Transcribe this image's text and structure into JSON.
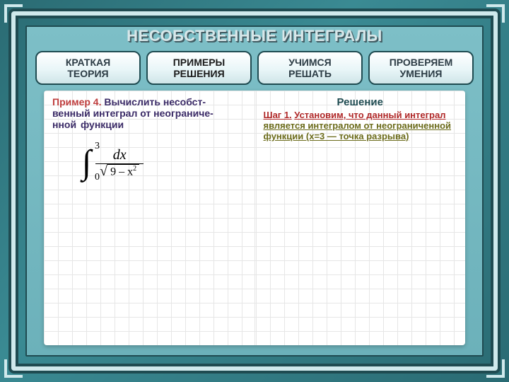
{
  "title": "НЕСОБСТВЕННЫЕ ИНТЕГРАЛЫ",
  "tabs": {
    "theory": "КРАТКАЯ\nТЕОРИЯ",
    "examples": "ПРИМЕРЫ\nРЕШЕНИЯ",
    "learn": "УЧИМСЯ\nРЕШАТЬ",
    "check": "ПРОВЕРЯЕМ\nУМЕНИЯ"
  },
  "left": {
    "example_label": "Пример 4.",
    "task_line1": "Вычислить несобст-",
    "task_line2": "венный интеграл от неограниче-",
    "task_line3": "нной",
    "task_line3b": "функции",
    "integral": {
      "upper": "3",
      "lower": "0",
      "numerator": "dx",
      "radicand": "9 – x",
      "exp": "2"
    }
  },
  "right": {
    "heading": "Решение",
    "step1_a": "Шаг 1.",
    "step1_b": "Установим, что данный интеграл",
    "step1_c": "является интегралом от неограниченной",
    "step1_d": "функции (x=3 — точка разрыва)"
  }
}
